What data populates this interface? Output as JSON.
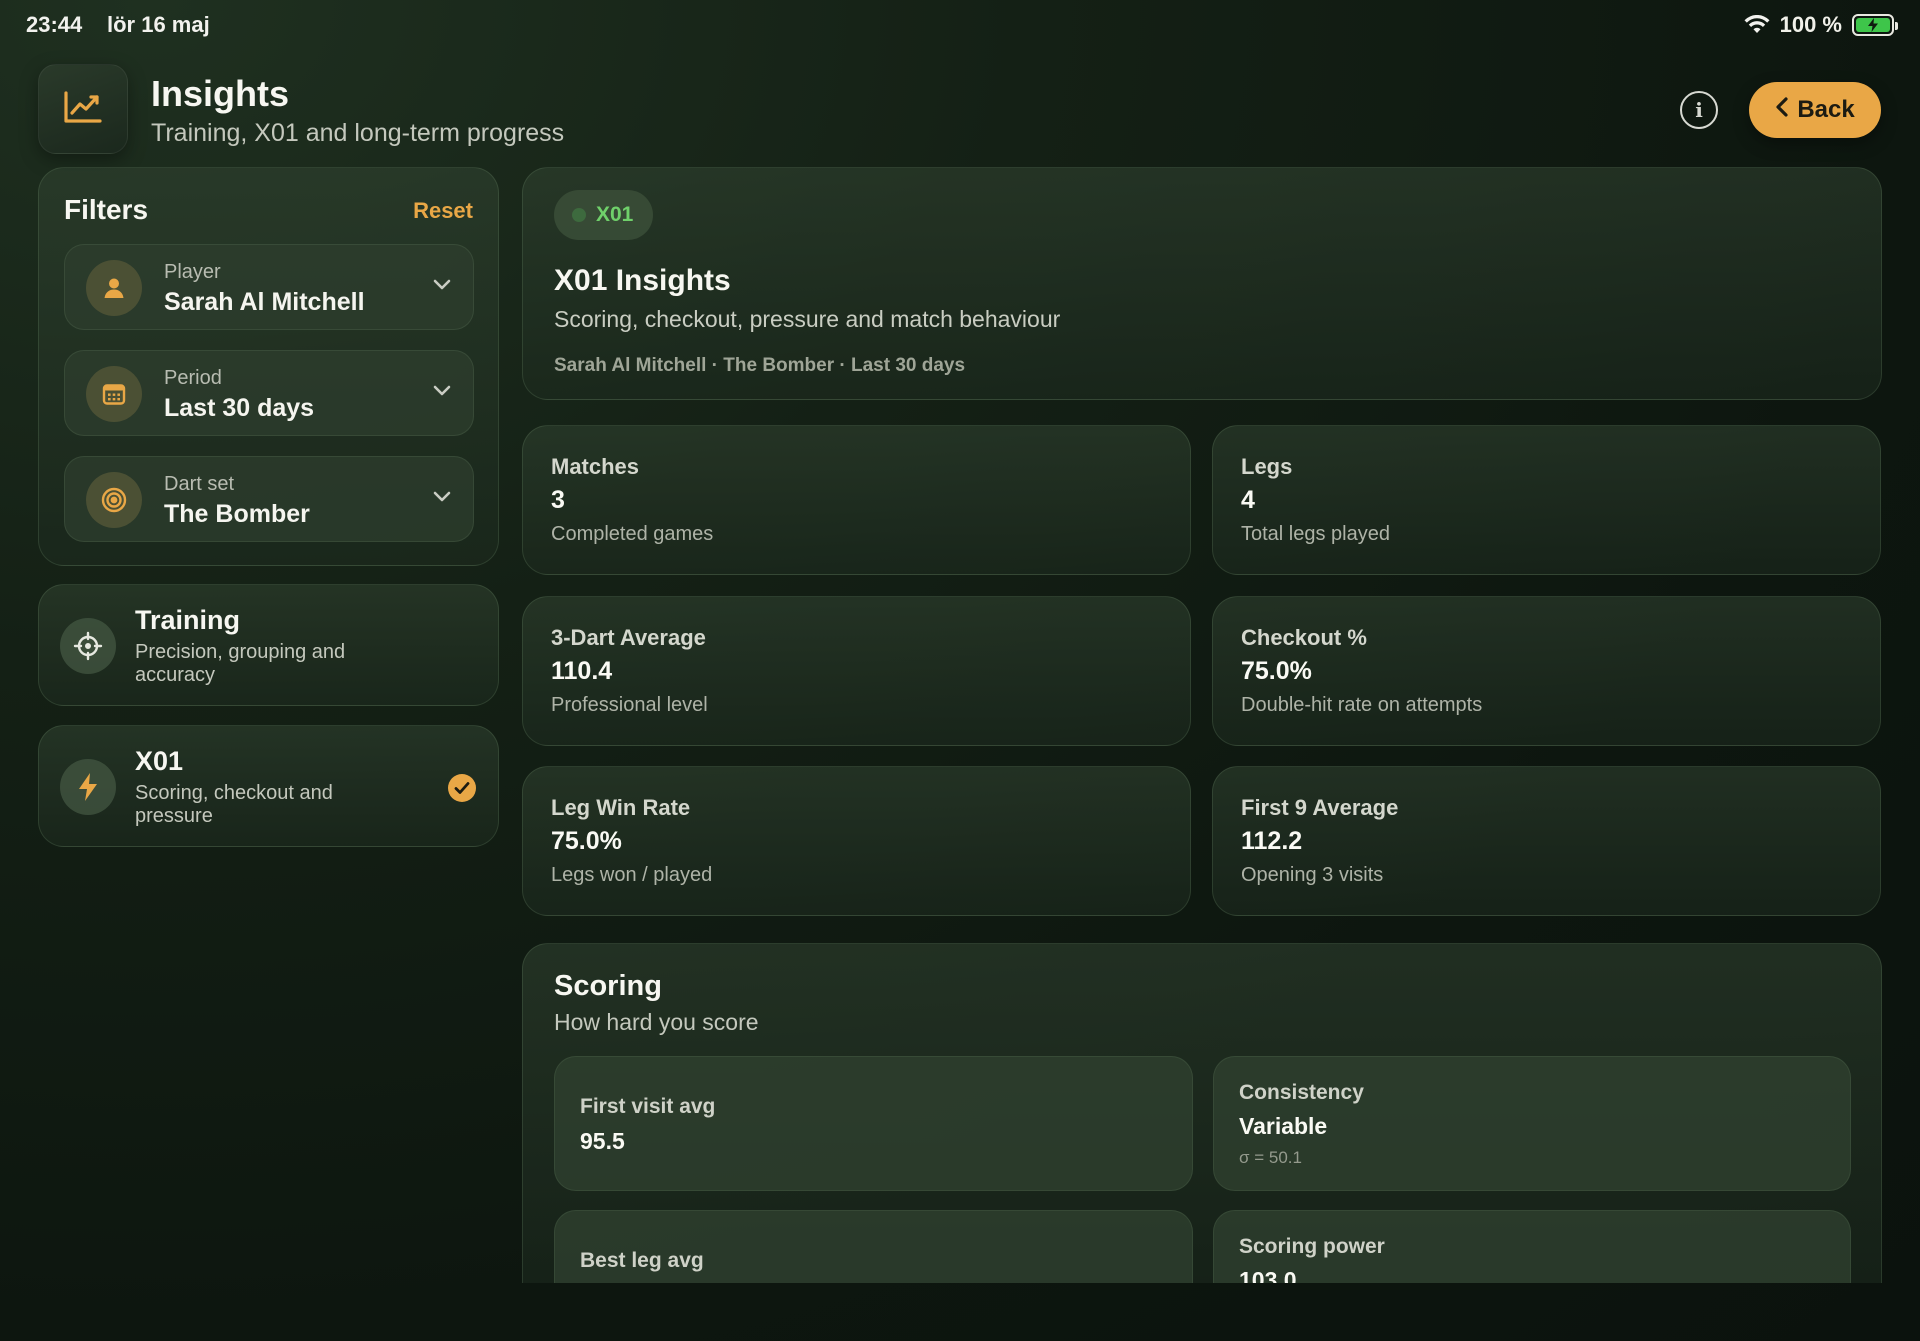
{
  "status_bar": {
    "time": "23:44",
    "date": "lör 16 maj",
    "battery": "100 %"
  },
  "header": {
    "title": "Insights",
    "subtitle": "Training, X01 and long-term progress",
    "back_label": "Back"
  },
  "filters": {
    "title": "Filters",
    "reset_label": "Reset",
    "rows": [
      {
        "label": "Player",
        "value": "Sarah Al Mitchell",
        "icon": "person-icon"
      },
      {
        "label": "Period",
        "value": "Last 30 days",
        "icon": "calendar-icon"
      },
      {
        "label": "Dart set",
        "value": "The Bomber",
        "icon": "target-icon"
      }
    ]
  },
  "modes": [
    {
      "title": "Training",
      "desc": "Precision, grouping and accuracy",
      "icon": "crosshair-icon",
      "selected": false
    },
    {
      "title": "X01",
      "desc": "Scoring, checkout and pressure",
      "icon": "bolt-icon",
      "selected": true
    }
  ],
  "insights": {
    "badge": "X01",
    "title": "X01 Insights",
    "subtitle": "Scoring, checkout, pressure and match behaviour",
    "meta": "Sarah Al Mitchell · The Bomber · Last 30 days"
  },
  "stats": [
    {
      "label": "Matches",
      "value": "3",
      "sub": "Completed games"
    },
    {
      "label": "Legs",
      "value": "4",
      "sub": "Total legs played"
    },
    {
      "label": "3-Dart Average",
      "value": "110.4",
      "sub": "Professional level"
    },
    {
      "label": "Checkout %",
      "value": "75.0%",
      "sub": "Double-hit rate on attempts"
    },
    {
      "label": "Leg Win Rate",
      "value": "75.0%",
      "sub": "Legs won / played"
    },
    {
      "label": "First 9 Average",
      "value": "112.2",
      "sub": "Opening 3 visits"
    }
  ],
  "scoring": {
    "title": "Scoring",
    "subtitle": "How hard you score",
    "tiles": [
      {
        "label": "First visit avg",
        "value": "95.5",
        "sub": ""
      },
      {
        "label": "Consistency",
        "value": "Variable",
        "sub": "σ = 50.1"
      },
      {
        "label": "Best leg avg",
        "value": "",
        "sub": ""
      },
      {
        "label": "Scoring power",
        "value": "103.0",
        "sub": ""
      }
    ]
  },
  "colors": {
    "accent": "#e9a746",
    "badge_green": "#6fd06a",
    "battery_green": "#3ec54a"
  }
}
